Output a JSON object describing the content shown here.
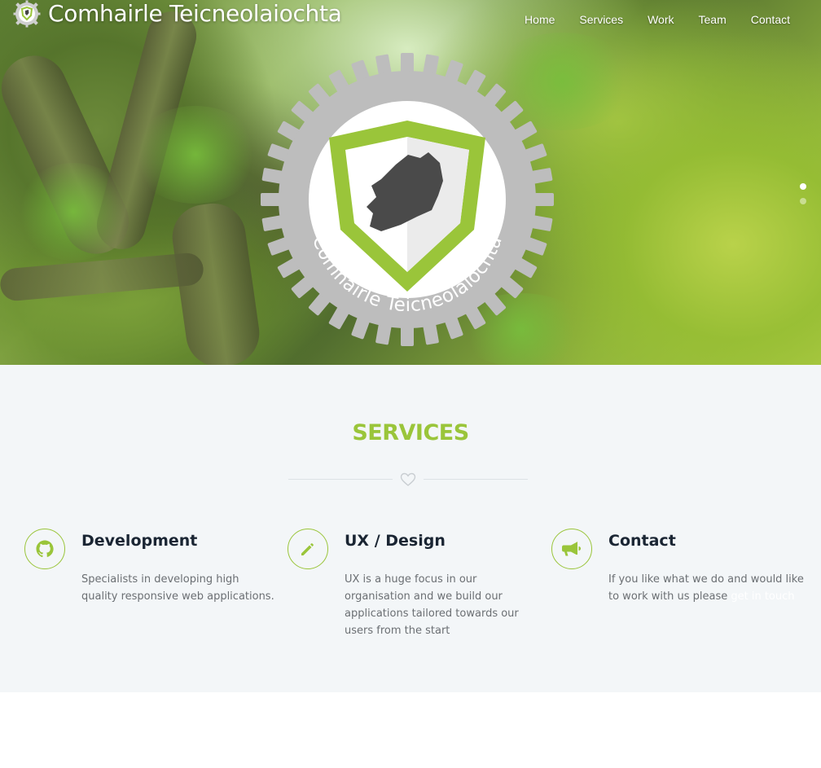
{
  "brand": {
    "name": "Comhairle Teicneolaiochta",
    "logo": "shield-gear-logo-icon"
  },
  "nav": [
    {
      "label": "Home"
    },
    {
      "label": "Services"
    },
    {
      "label": "Work"
    },
    {
      "label": "Team"
    },
    {
      "label": "Contact"
    }
  ],
  "hero": {
    "emblem_text": "Comhairle Teicneolaíochta",
    "emblem_icon": "gear-shield-ireland-icon",
    "slides_total": 2,
    "slide_active": 1
  },
  "services": {
    "title": "SERVICES",
    "divider_icon": "heart-icon",
    "items": [
      {
        "icon": "github-icon",
        "title": "Development",
        "text": "Specialists in developing high quality responsive web applications."
      },
      {
        "icon": "pencil-icon",
        "title": "UX / Design",
        "text": "UX is a huge focus in our organisation and we build our applications tailored towards our users from the start"
      },
      {
        "icon": "megaphone-icon",
        "title": "Contact",
        "text": "If you like what we do and would like to work with us please ",
        "link": "get in touch"
      }
    ]
  },
  "colors": {
    "accent": "#9ac53a",
    "gear": "#bdbdbd",
    "section_bg": "#f3f6f8",
    "heading": "#1a2533",
    "body_text": "#6b6f73"
  }
}
